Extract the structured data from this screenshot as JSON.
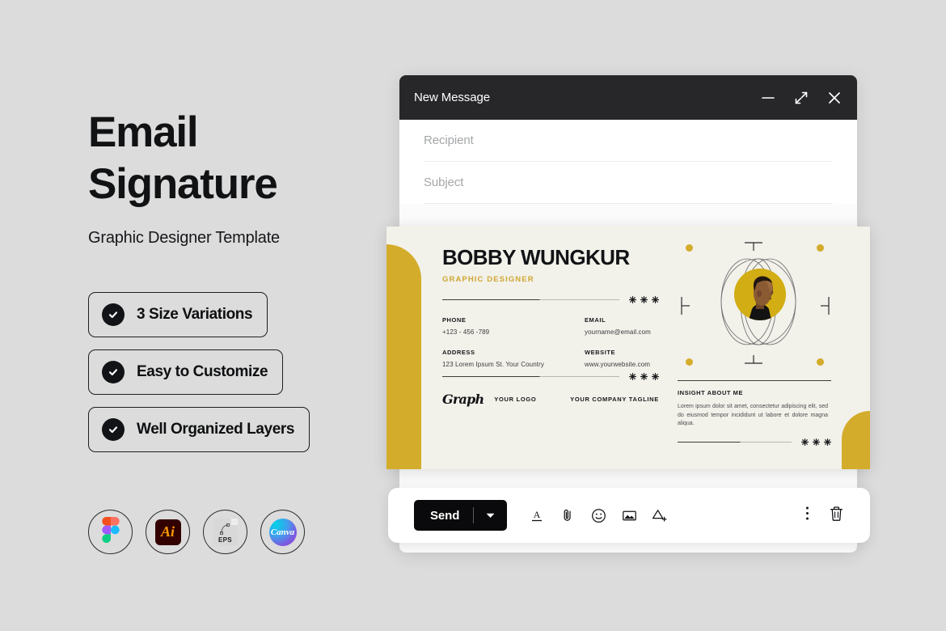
{
  "promo": {
    "title_line1": "Email",
    "title_line2": "Signature",
    "subtitle": "Graphic Designer Template",
    "badges": [
      {
        "label": "3 Size Variations",
        "icon": "check-circle-icon"
      },
      {
        "label": "Easy to Customize",
        "icon": "check-circle-icon"
      },
      {
        "label": "Well Organized Layers",
        "icon": "check-circle-icon"
      }
    ],
    "apps": [
      {
        "name": "figma-icon",
        "label": ""
      },
      {
        "name": "adobe-illustrator-icon",
        "label": "Ai"
      },
      {
        "name": "eps-file-icon",
        "label": "EPS"
      },
      {
        "name": "canva-icon",
        "label": "Canva"
      }
    ]
  },
  "mail": {
    "title": "New Message",
    "window_controls": [
      {
        "name": "minimize-icon",
        "label": "—"
      },
      {
        "name": "expand-icon",
        "label": "↗"
      },
      {
        "name": "close-icon",
        "label": "✕"
      }
    ],
    "fields": [
      {
        "name": "recipient",
        "placeholder": "Recipient",
        "value": ""
      },
      {
        "name": "subject",
        "placeholder": "Subject",
        "value": ""
      }
    ],
    "toolbar": {
      "send_label": "Send",
      "send_caret": "▼",
      "icons": [
        {
          "name": "format-text-icon",
          "label": "A"
        },
        {
          "name": "attach-file-icon",
          "label": "📎"
        },
        {
          "name": "insert-emoji-icon",
          "label": "☺"
        },
        {
          "name": "insert-image-icon",
          "label": "🖼"
        },
        {
          "name": "insert-drive-icon",
          "label": "△+"
        }
      ],
      "more_options": "⋮",
      "discard": "🗑"
    }
  },
  "signature": {
    "name": "BOBBY WUNGKUR",
    "role": "GRAPHIC DESIGNER",
    "contacts": [
      {
        "label": "PHONE",
        "value": "+123 - 456 -789"
      },
      {
        "label": "EMAIL",
        "value": "yourname@email.com"
      },
      {
        "label": "ADDRESS",
        "value": "123 Lorem Ipsum St. Your Country"
      },
      {
        "label": "WEBSITE",
        "value": "www.yourwebsite.com"
      }
    ],
    "logo_mark": "Graph",
    "logo_text": "YOUR LOGO",
    "tagline": "YOUR COMPANY TAGLINE",
    "insight_title": "INSIGHT ABOUT ME",
    "insight_body": "Lorem ipsum dolor sit amet, consectetur adipiscing elit, sed do eiusmod tempor incididunt ut labore et dolore magna aliqua.",
    "star_glyph": "✻",
    "accent_color": "#d4ac2b",
    "card_bg": "#f2f1ea"
  }
}
